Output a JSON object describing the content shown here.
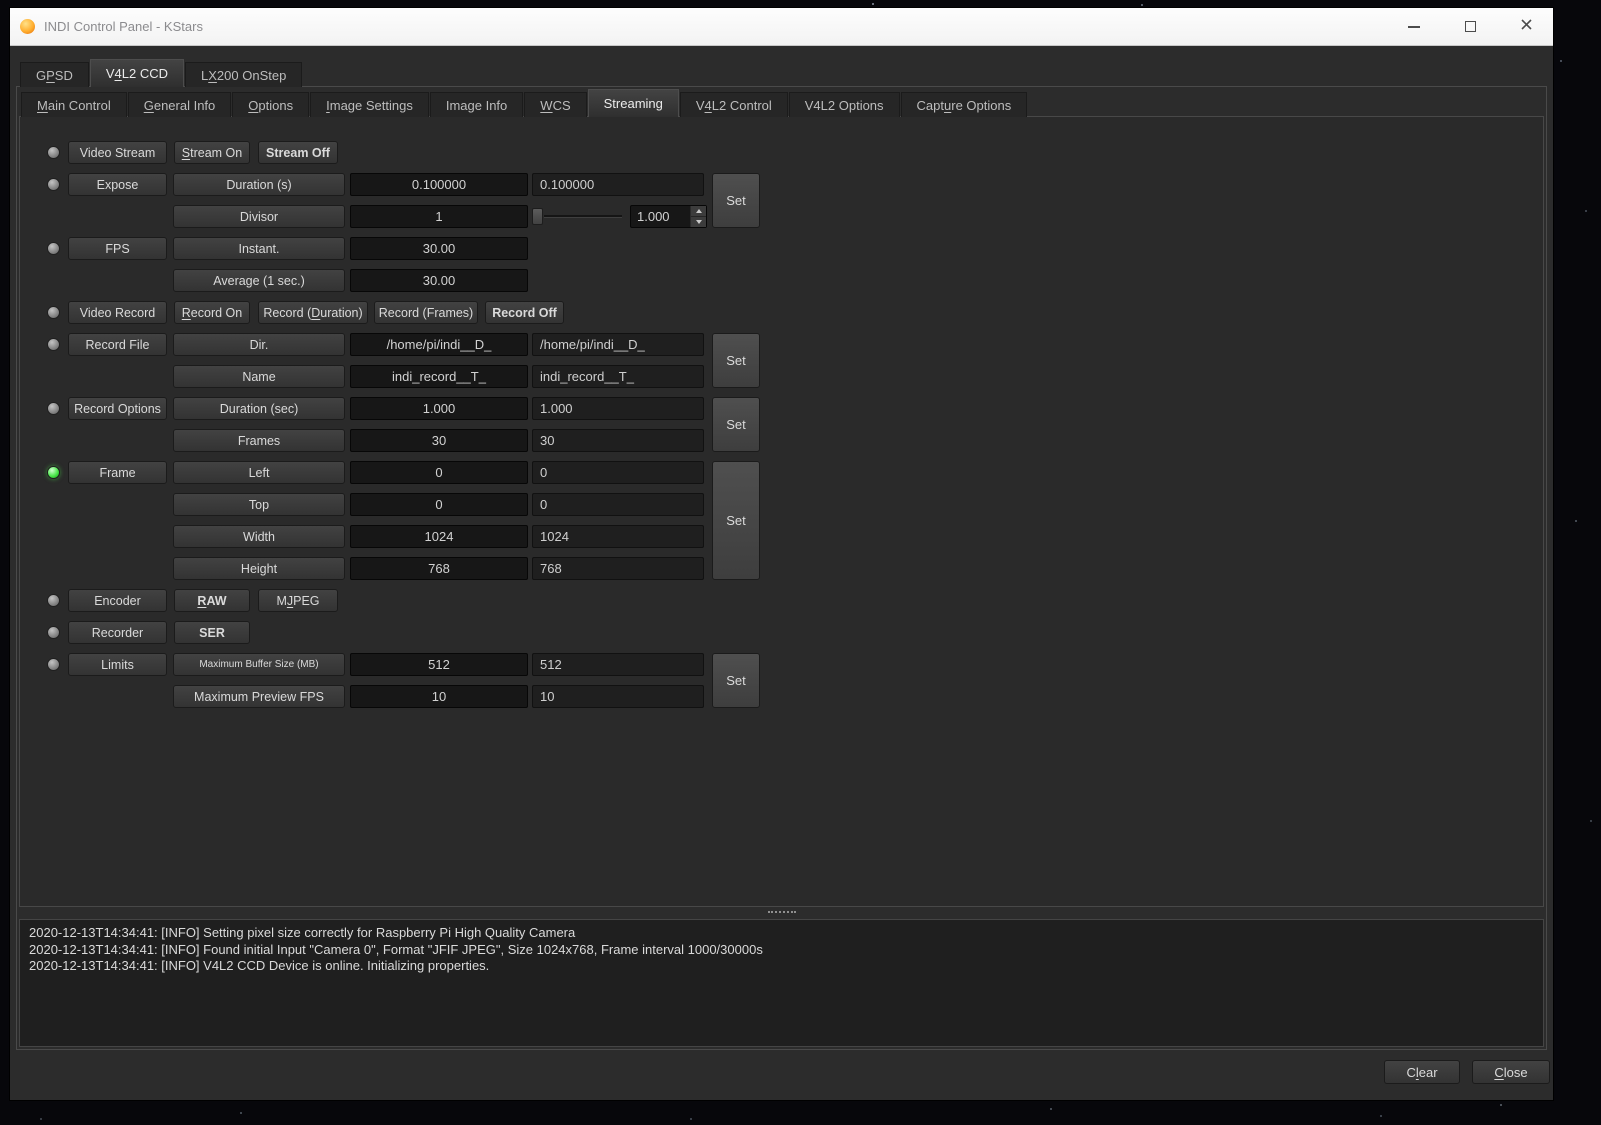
{
  "window": {
    "title": "INDI Control Panel - KStars"
  },
  "device_tabs": [
    {
      "label": "GPSD"
    },
    {
      "label": "V4L2 CCD"
    },
    {
      "label": "LX200 OnStep"
    }
  ],
  "property_tabs": [
    {
      "label": "Main Control"
    },
    {
      "label": "General Info"
    },
    {
      "label": "Options"
    },
    {
      "label": "Image Settings"
    },
    {
      "label": "Image Info"
    },
    {
      "label": "WCS"
    },
    {
      "label": "Streaming"
    },
    {
      "label": "V4L2 Control"
    },
    {
      "label": "V4L2 Options"
    },
    {
      "label": "Capture Options"
    }
  ],
  "streaming": {
    "video_stream": {
      "label": "Video Stream",
      "stream_on": "Stream On",
      "stream_off": "Stream Off"
    },
    "expose": {
      "label": "Expose",
      "duration": {
        "name": "Duration (s)",
        "input": "0.100000",
        "current": "0.100000"
      },
      "divisor": {
        "name": "Divisor",
        "input": "1",
        "spin": "1.000"
      },
      "set": "Set"
    },
    "fps": {
      "label": "FPS",
      "instant": {
        "name": "Instant.",
        "value": "30.00"
      },
      "average": {
        "name": "Average (1 sec.)",
        "value": "30.00"
      }
    },
    "video_record": {
      "label": "Video Record",
      "record_on": "Record On",
      "record_duration": "Record (Duration)",
      "record_frames": "Record (Frames)",
      "record_off": "Record Off"
    },
    "record_file": {
      "label": "Record File",
      "dir": {
        "name": "Dir.",
        "input": "/home/pi/indi__D_",
        "current": "/home/pi/indi__D_"
      },
      "name": {
        "name": "Name",
        "input": "indi_record__T_",
        "current": "indi_record__T_"
      },
      "set": "Set"
    },
    "record_options": {
      "label": "Record Options",
      "duration": {
        "name": "Duration (sec)",
        "input": "1.000",
        "current": "1.000"
      },
      "frames": {
        "name": "Frames",
        "input": "30",
        "current": "30"
      },
      "set": "Set"
    },
    "frame": {
      "label": "Frame",
      "left": {
        "name": "Left",
        "input": "0",
        "current": "0"
      },
      "top": {
        "name": "Top",
        "input": "0",
        "current": "0"
      },
      "width": {
        "name": "Width",
        "input": "1024",
        "current": "1024"
      },
      "height": {
        "name": "Height",
        "input": "768",
        "current": "768"
      },
      "set": "Set"
    },
    "encoder": {
      "label": "Encoder",
      "raw": "RAW",
      "mjpeg": "MJPEG"
    },
    "recorder": {
      "label": "Recorder",
      "ser": "SER"
    },
    "limits": {
      "label": "Limits",
      "buffer": {
        "name": "Maximum Buffer Size (MB)",
        "input": "512",
        "current": "512"
      },
      "preview": {
        "name": "Maximum Preview FPS",
        "input": "10",
        "current": "10"
      },
      "set": "Set"
    }
  },
  "log": {
    "lines": [
      "2020-12-13T14:34:41: [INFO] Setting pixel size correctly for Raspberry Pi High Quality Camera",
      "2020-12-13T14:34:41: [INFO] Found initial Input \"Camera 0\", Format \"JFIF JPEG\", Size 1024x768, Frame interval 1000/30000s",
      "2020-12-13T14:34:41: [INFO] V4L2 CCD Device is online. Initializing properties."
    ]
  },
  "footer": {
    "clear": "Clear",
    "close": "Close"
  }
}
